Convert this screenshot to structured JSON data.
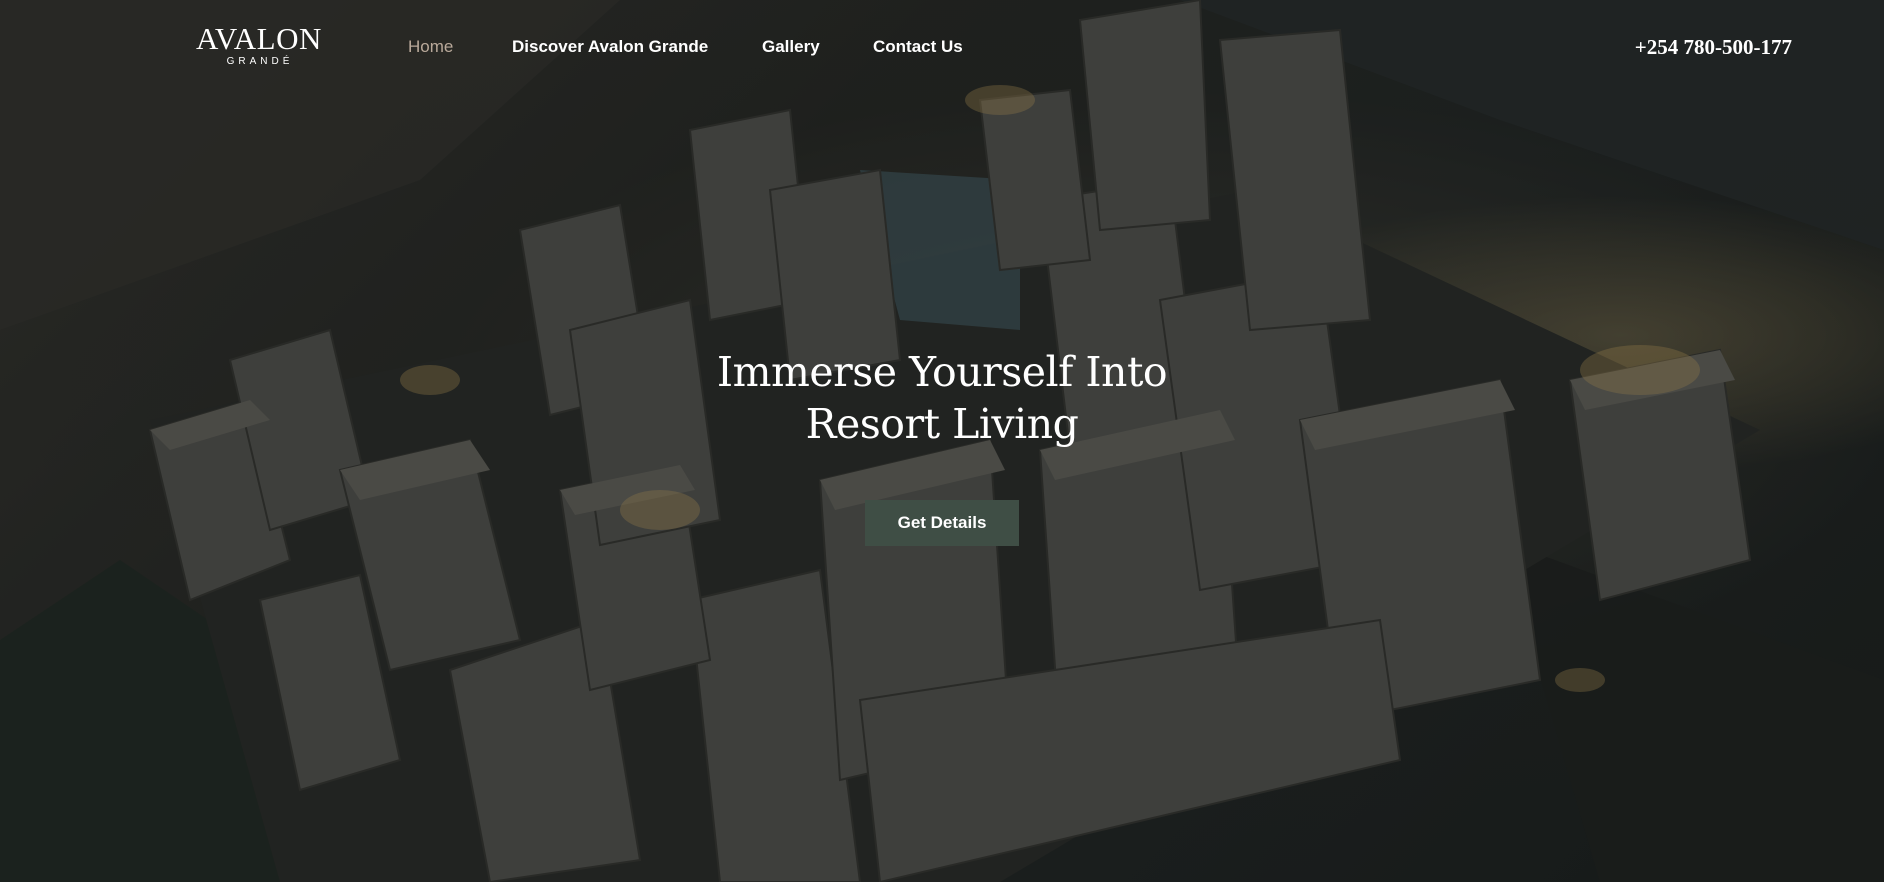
{
  "logo": {
    "main": "AVALON",
    "sub": "GRANDÉ"
  },
  "nav": {
    "items": [
      {
        "label": "Home",
        "active": true
      },
      {
        "label": "Discover Avalon Grande",
        "active": false
      },
      {
        "label": "Gallery",
        "active": false
      },
      {
        "label": "Contact Us",
        "active": false
      }
    ]
  },
  "header": {
    "phone": "+254 780-500-177"
  },
  "hero": {
    "title": "Immerse Yourself Into Resort Living",
    "cta_label": "Get Details",
    "background": "aerial-night-city-render"
  },
  "colors": {
    "nav_active": "#b9a99a",
    "cta_background": "#3f4e45",
    "text": "#ffffff"
  }
}
